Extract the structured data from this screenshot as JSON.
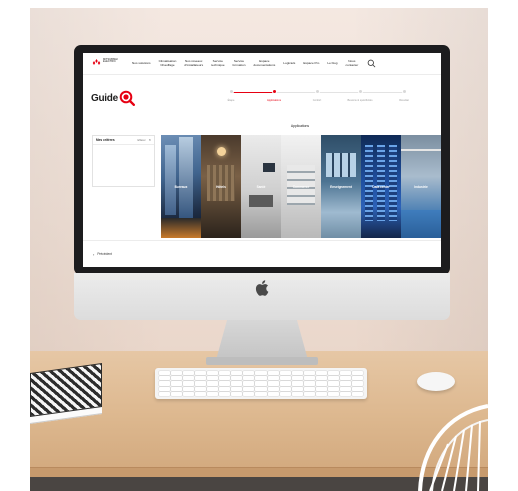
{
  "colors": {
    "brand_red": "#e60012",
    "bezel": "#1c1c1e",
    "wall": "#f2e4dc",
    "desk": "#ddb88f"
  },
  "icons": {
    "brand": "mitsubishi-diamond-icon",
    "search": "search-icon",
    "guide": "magnifier-icon",
    "apple": "apple-logo-icon",
    "prev": "chevron-left-icon",
    "close": "close-icon"
  },
  "nav": {
    "brand_text": "MITSUBISHI\nELECTRIC",
    "items": [
      {
        "label": "Nos solutions"
      },
      {
        "label": "Climatisation\nChauffage"
      },
      {
        "label": "Nos réseaux\nd'installateurs"
      },
      {
        "label": "Service\ntechnique"
      },
      {
        "label": "Service\nformation"
      },
      {
        "label": "Espace\ndocumentations"
      },
      {
        "label": "Logiciels"
      },
      {
        "label": "Espace Pro"
      },
      {
        "label": "Le blog"
      },
      {
        "label": "Nous\ncontacter"
      }
    ]
  },
  "guide": {
    "title": "Guide"
  },
  "steps": [
    {
      "label": "Étape"
    },
    {
      "label": "Applications"
    },
    {
      "label": "Confort"
    },
    {
      "label": "Besoins & spécificités"
    },
    {
      "label": "Résultat"
    }
  ],
  "steps_state": {
    "active_index": 1,
    "progress_fraction": 0.25
  },
  "sidebar": {
    "title": "Mes critères",
    "action": "Effacer"
  },
  "main": {
    "section_title": "Applications",
    "applications": [
      {
        "label": "Bureaux"
      },
      {
        "label": "Hôtels"
      },
      {
        "label": "Santé"
      },
      {
        "label": "Commerce"
      },
      {
        "label": "Enseignement"
      },
      {
        "label": "Data center"
      },
      {
        "label": "Industrie"
      }
    ]
  },
  "footer": {
    "prev_label": "Précédent"
  }
}
